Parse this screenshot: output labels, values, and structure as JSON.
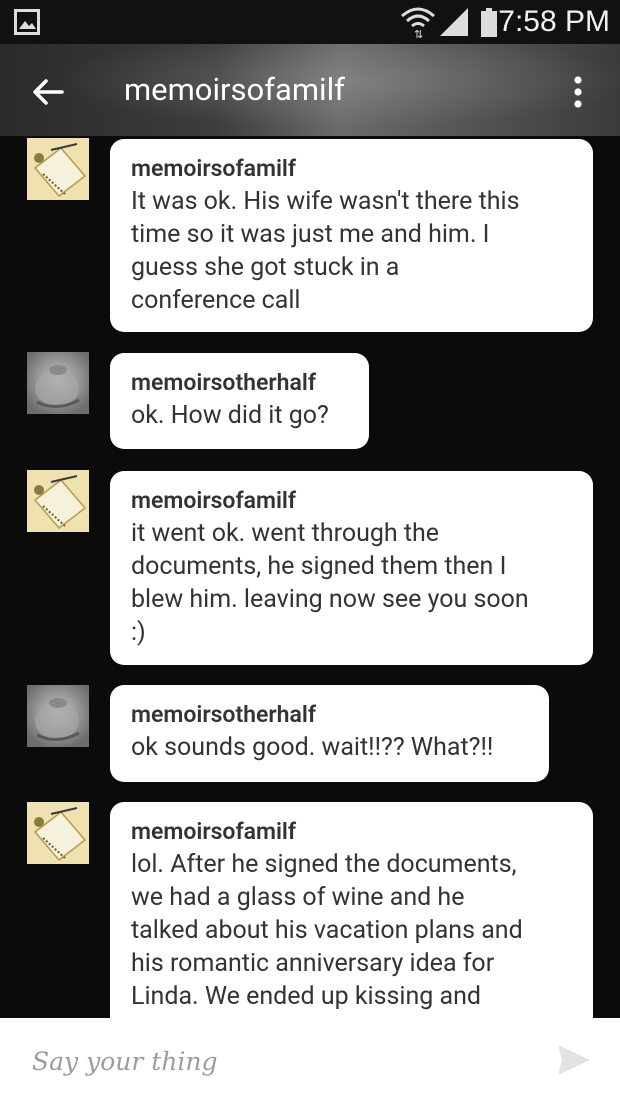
{
  "status_bar": {
    "time": "7:58 PM",
    "icons": [
      "gallery-icon",
      "wifi-icon",
      "signal-icon",
      "battery-icon"
    ]
  },
  "app_bar": {
    "title": "memoirsofamilf",
    "icons": [
      "back-arrow-icon",
      "overflow-menu-icon"
    ]
  },
  "messages": [
    {
      "sender": "memoirsofamilf",
      "avatar": "notebook-avatar",
      "text": "It was ok. His wife wasn't there this\ntime so it was just me and him. I\nguess she got stuck in a\nconference call"
    },
    {
      "sender": "memoirsotherhalf",
      "avatar": "face-avatar",
      "text": "ok. How did it go?"
    },
    {
      "sender": "memoirsofamilf",
      "avatar": "notebook-avatar",
      "text": "it went ok. went through the\ndocuments, he signed them then  I\nblew him. leaving now see you soon\n:)"
    },
    {
      "sender": "memoirsotherhalf",
      "avatar": "face-avatar",
      "text": "ok sounds good. wait!!?? What?!!"
    },
    {
      "sender": "memoirsofamilf",
      "avatar": "notebook-avatar",
      "text": "lol. After he signed the documents,\nwe had a glass of wine and he\ntalked about his vacation plans and\nhis romantic anniversary idea for\nLinda. We ended up kissing and"
    }
  ],
  "composer": {
    "placeholder": "Say your thing",
    "send_icon": "send-icon"
  },
  "colors": {
    "background": "#0b0b0b",
    "bubble": "#ffffff",
    "text": "#333333",
    "placeholder": "#9c9c9c"
  }
}
